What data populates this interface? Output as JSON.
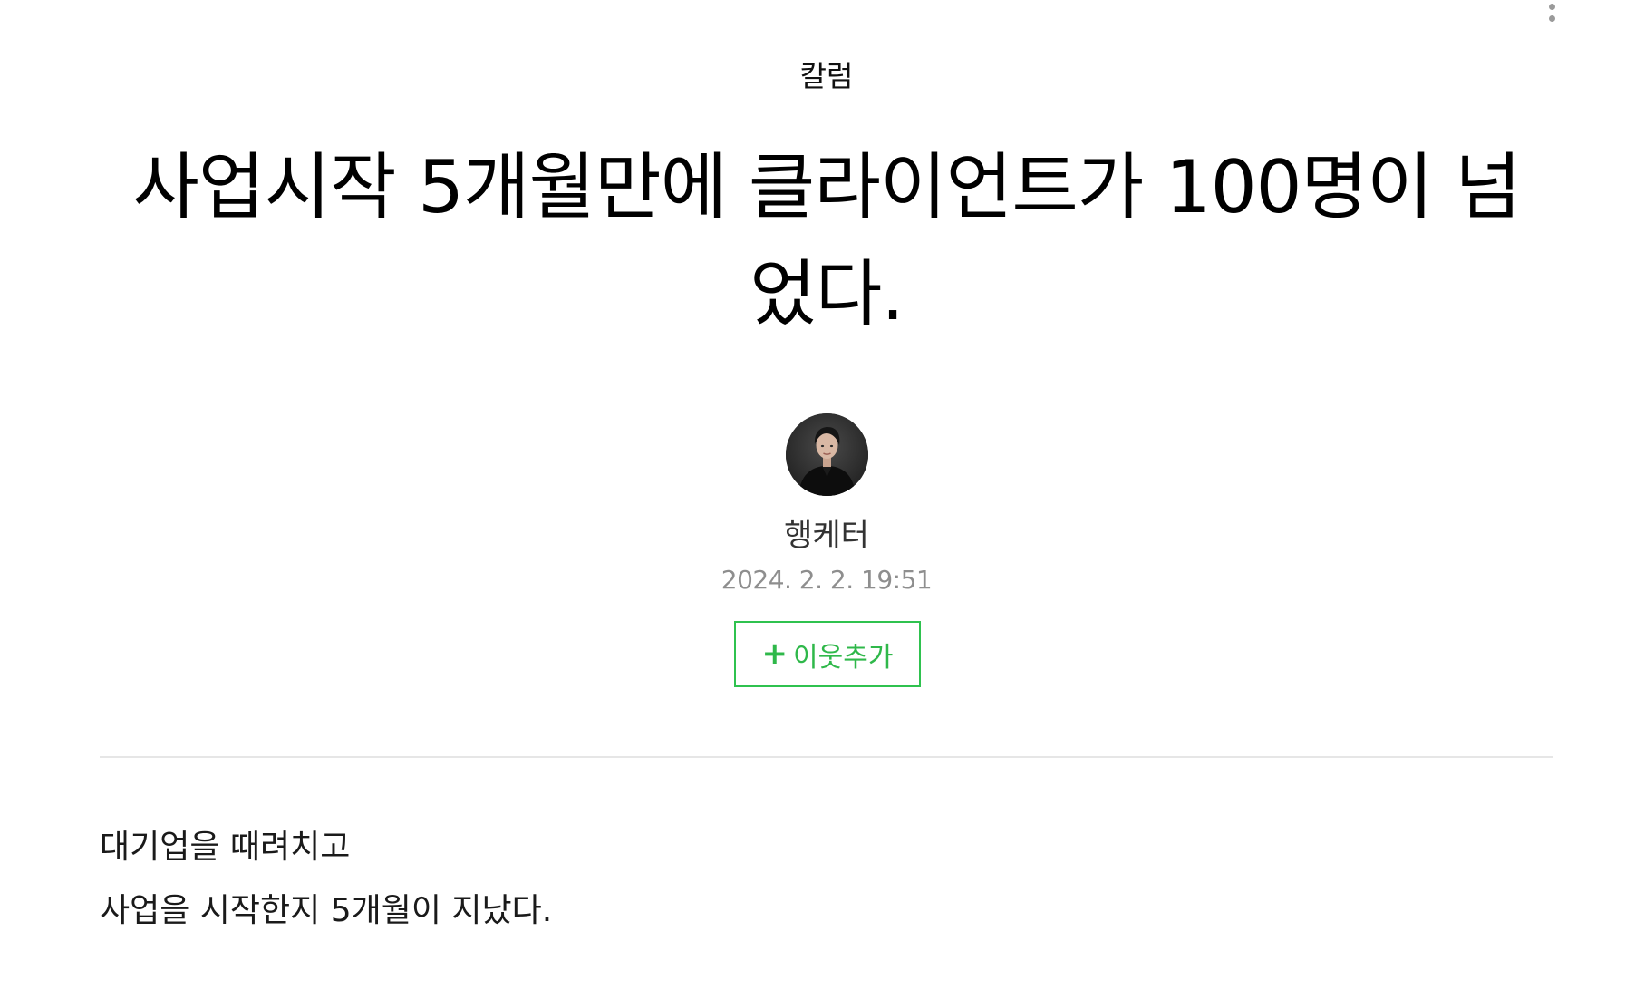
{
  "category": "칼럼",
  "post": {
    "title": "사업시작 5개월만에 클라이언트가 100명이 넘었다."
  },
  "author": {
    "name": "행케터",
    "date": "2024. 2. 2. 19:51",
    "avatar_icon": "profile-photo"
  },
  "follow": {
    "icon": "plus-icon",
    "plus": "+",
    "label": "이웃추가",
    "color": "#2fc24f"
  },
  "menu": {
    "icon": "more-vertical-icon"
  },
  "body": {
    "lines": [
      "대기업을 때려치고",
      "사업을 시작한지 5개월이 지났다."
    ]
  }
}
